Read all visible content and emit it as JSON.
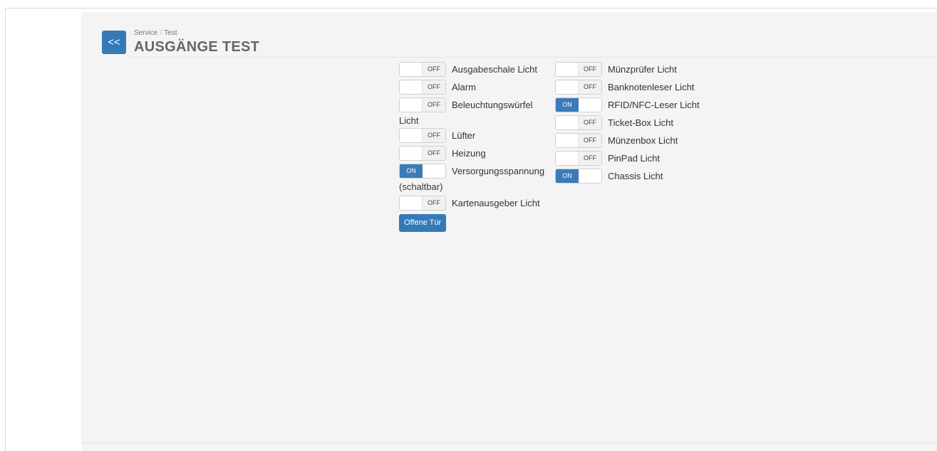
{
  "breadcrumb": {
    "section": "Service",
    "separator": "/",
    "page": "Test"
  },
  "title": "AUSGÄNGE TEST",
  "back_label": "<<",
  "toggle_text": {
    "on": "ON",
    "off": "OFF"
  },
  "left_outputs": [
    {
      "label": "Ausgabeschale Licht",
      "state": "off"
    },
    {
      "label": "Alarm",
      "state": "off"
    },
    {
      "label": "Beleuchtungswürfel",
      "label_cont": "Licht",
      "state": "off"
    },
    {
      "label": "Lüfter",
      "state": "off"
    },
    {
      "label": "Heizung",
      "state": "off"
    },
    {
      "label": "Versorgungsspannung",
      "label_cont": "(schaltbar)",
      "state": "on"
    },
    {
      "label": "Kartenausgeber Licht",
      "state": "off"
    }
  ],
  "right_outputs": [
    {
      "label": "Münzprüfer Licht",
      "state": "off"
    },
    {
      "label": "Banknotenleser Licht",
      "state": "off"
    },
    {
      "label": "RFID/NFC-Leser Licht",
      "state": "on"
    },
    {
      "label": "Ticket-Box Licht",
      "state": "off"
    },
    {
      "label": "Münzenbox Licht",
      "state": "off"
    },
    {
      "label": "PinPad Licht",
      "state": "off"
    },
    {
      "label": "Chassis Licht",
      "state": "on"
    }
  ],
  "open_door_label": "Offene Tür",
  "colors": {
    "primary": "#337ab7",
    "panel_bg": "#f4f4f4"
  }
}
